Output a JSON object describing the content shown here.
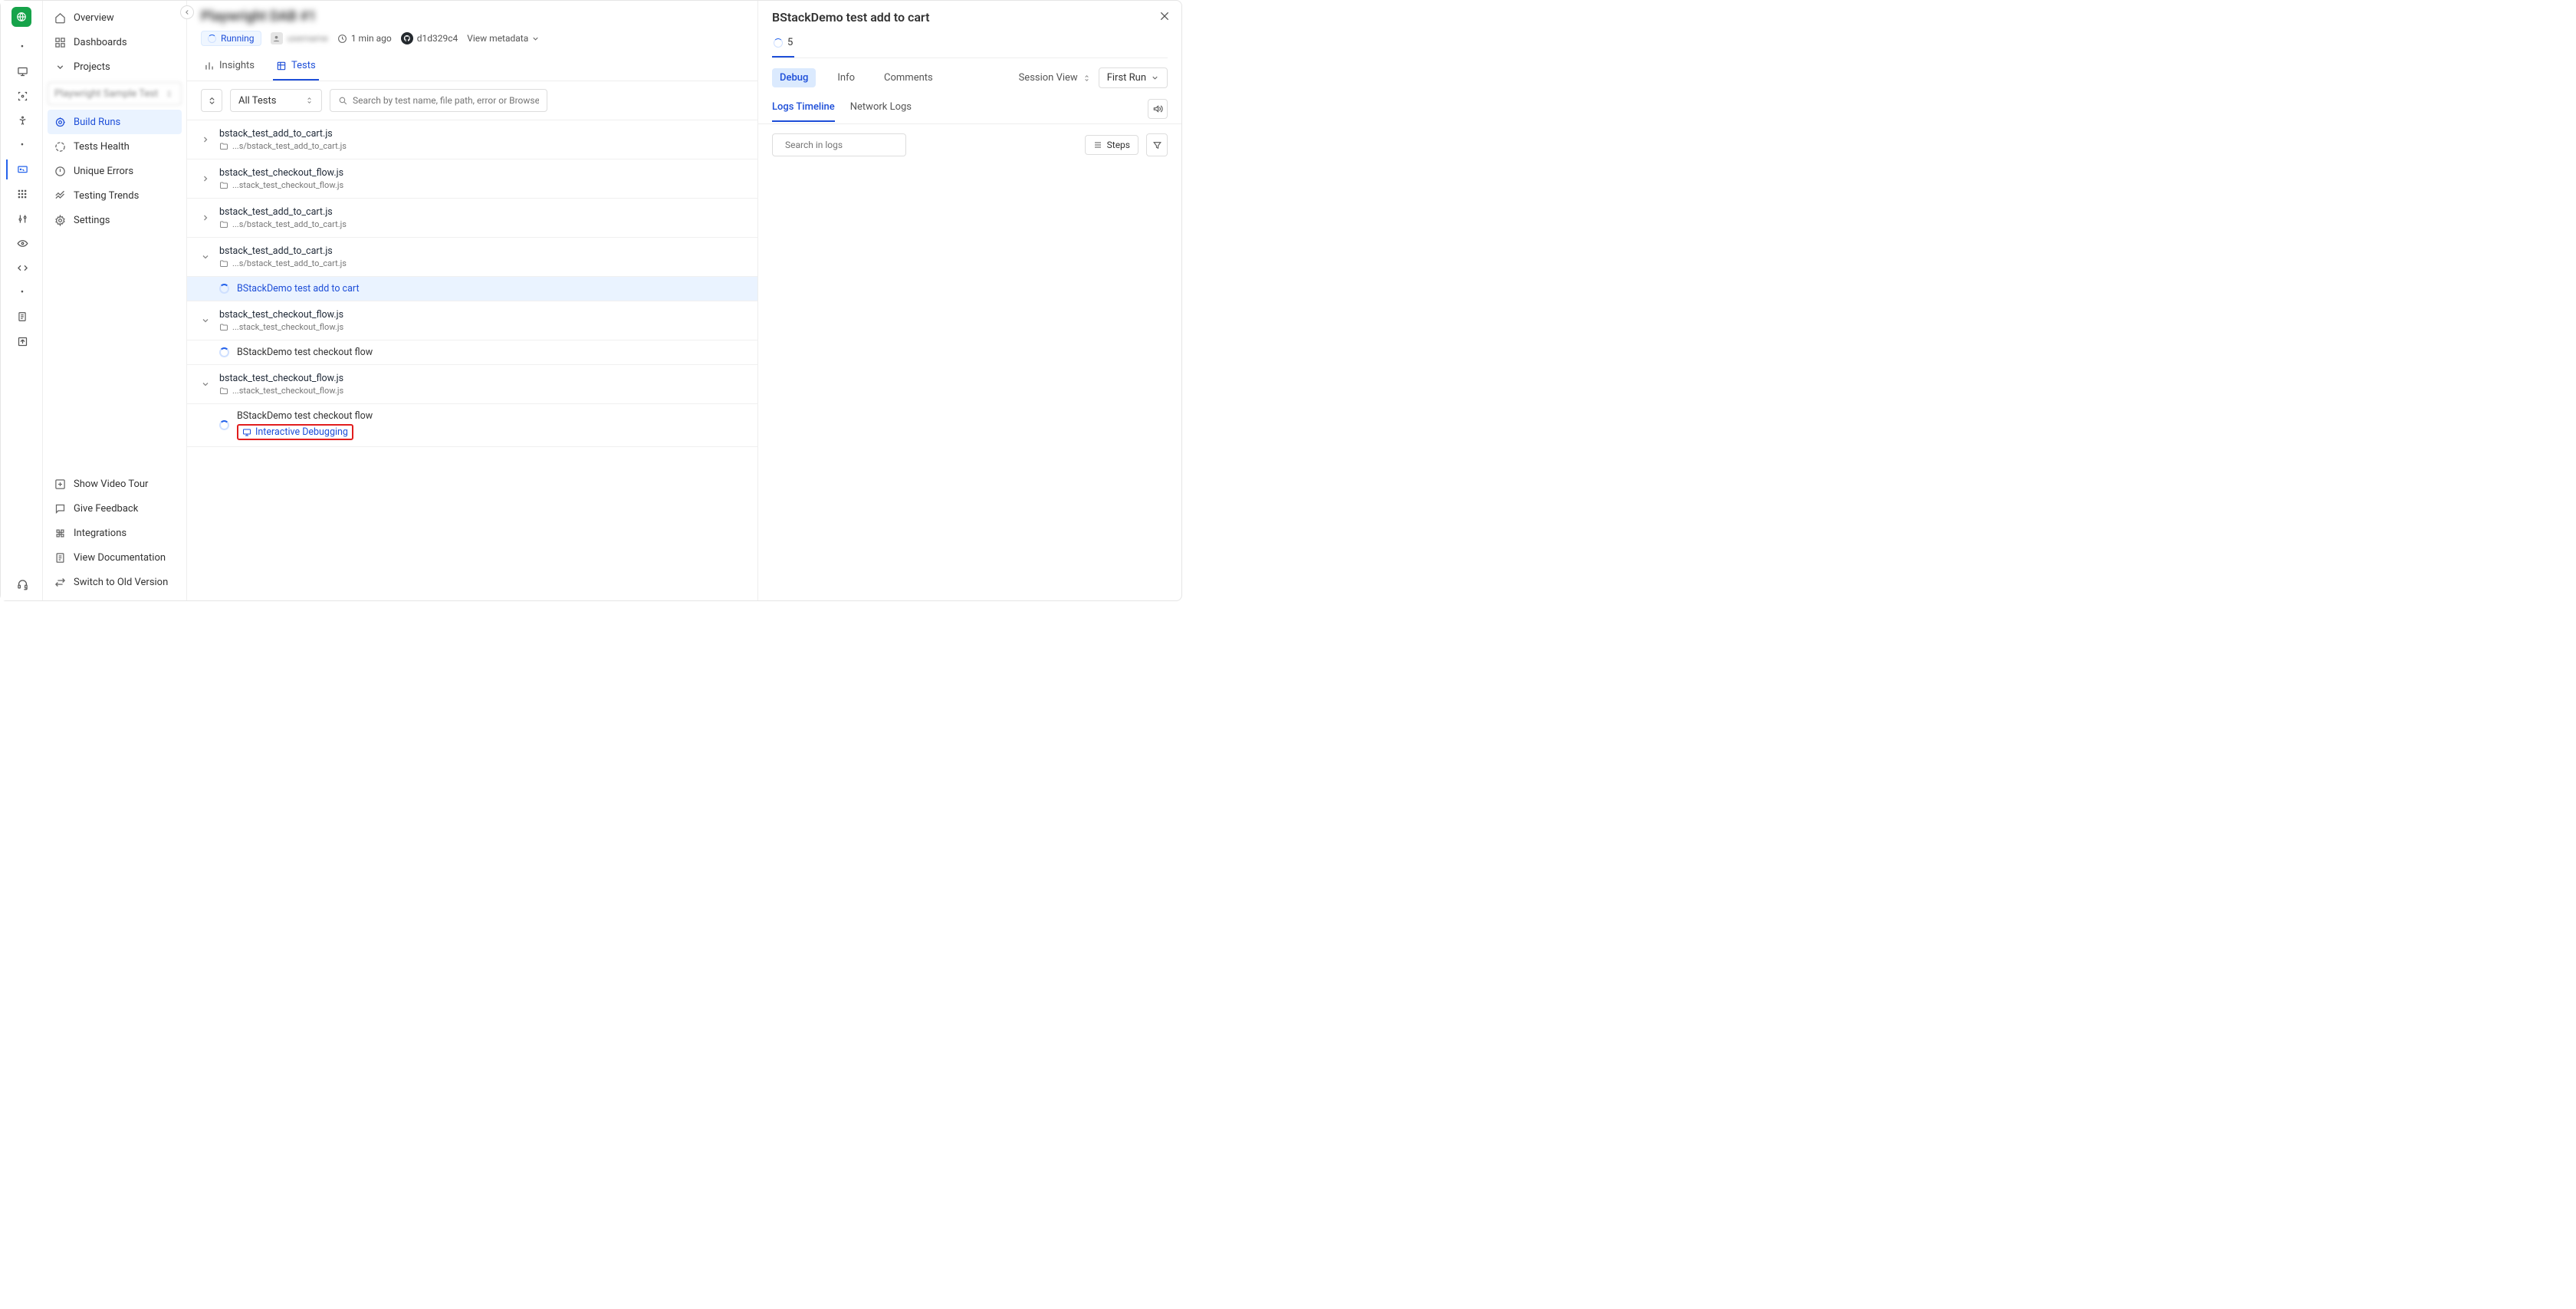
{
  "rail": {},
  "sidebar": {
    "overview": "Overview",
    "dashboards": "Dashboards",
    "projects": "Projects",
    "selected_project": "Playwright Sample Test",
    "build_runs": "Build Runs",
    "tests_health": "Tests Health",
    "unique_errors": "Unique Errors",
    "testing_trends": "Testing Trends",
    "settings": "Settings",
    "show_video": "Show Video Tour",
    "give_feedback": "Give Feedback",
    "integrations": "Integrations",
    "view_docs": "View Documentation",
    "switch_old": "Switch to Old Version"
  },
  "main": {
    "project_title": "Playwright DAB #1",
    "status_badge": "Running",
    "user": "username",
    "time_ago": "1 min ago",
    "commit": "d1d329c4",
    "view_metadata": "View metadata",
    "tab_insights": "Insights",
    "tab_tests": "Tests",
    "all_tests": "All Tests",
    "search_placeholder": "Search by test name, file path, error or BrowserStack",
    "groups": [
      {
        "name": "bstack_test_add_to_cart.js",
        "path": "...s/bstack_test_add_to_cart.js",
        "expanded": false
      },
      {
        "name": "bstack_test_checkout_flow.js",
        "path": "...stack_test_checkout_flow.js",
        "expanded": false
      },
      {
        "name": "bstack_test_add_to_cart.js",
        "path": "...s/bstack_test_add_to_cart.js",
        "expanded": false
      },
      {
        "name": "bstack_test_add_to_cart.js",
        "path": "...s/bstack_test_add_to_cart.js",
        "expanded": true,
        "tests": [
          {
            "name": "BStackDemo test add to cart",
            "selected": true
          }
        ]
      },
      {
        "name": "bstack_test_checkout_flow.js",
        "path": "...stack_test_checkout_flow.js",
        "expanded": true,
        "tests": [
          {
            "name": "BStackDemo test checkout flow",
            "selected": false
          }
        ]
      },
      {
        "name": "bstack_test_checkout_flow.js",
        "path": "...stack_test_checkout_flow.js",
        "expanded": true,
        "tests": [
          {
            "name": "BStackDemo test checkout flow",
            "selected": false,
            "debug_link": "Interactive Debugging"
          }
        ]
      }
    ]
  },
  "details": {
    "title": "BStackDemo test add to cart",
    "count": "5",
    "tabs": {
      "debug": "Debug",
      "info": "Info",
      "comments": "Comments"
    },
    "session_view": "Session View",
    "first_run": "First Run",
    "subtabs": {
      "logs_timeline": "Logs Timeline",
      "network_logs": "Network Logs"
    },
    "log_search_placeholder": "Search in logs",
    "steps": "Steps"
  }
}
